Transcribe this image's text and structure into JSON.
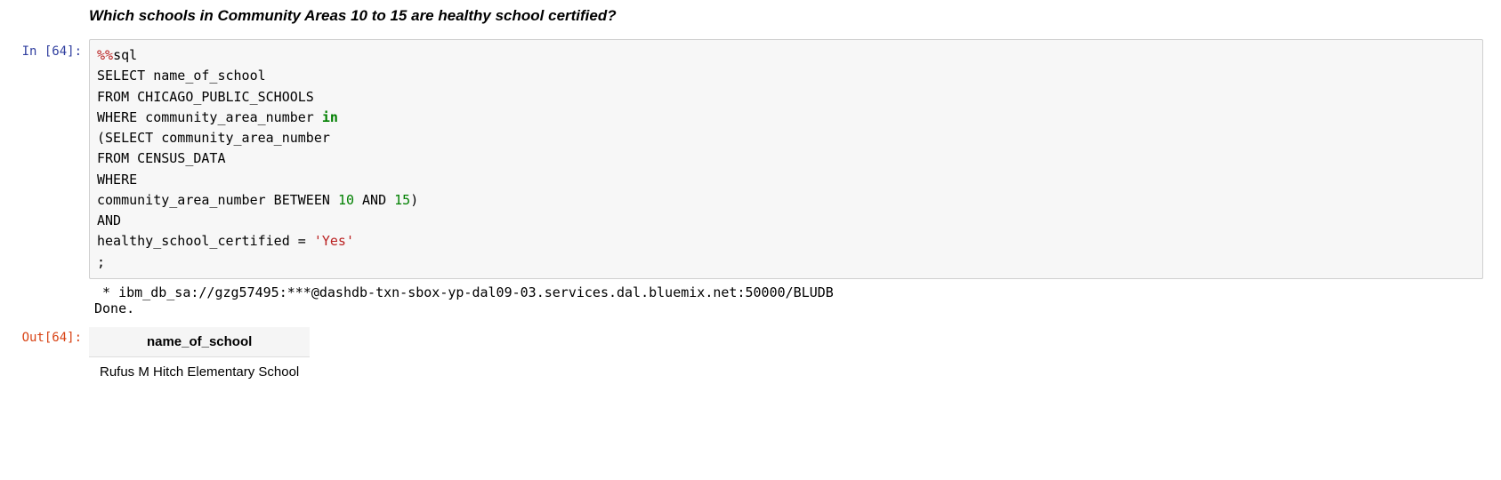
{
  "markdown": {
    "heading": "Which schools in Community Areas 10 to 15 are healthy school certified?"
  },
  "input": {
    "prompt": "In [64]:",
    "code": {
      "magic": "%%",
      "magic_name": "sql",
      "line1": "SELECT name_of_school",
      "line2": "FROM CHICAGO_PUBLIC_SCHOOLS",
      "line3a": "WHERE community_area_number ",
      "kw_in": "in",
      "line4": "(SELECT community_area_number",
      "line5": "FROM CENSUS_DATA",
      "line6": "WHERE",
      "line7a": "community_area_number BETWEEN ",
      "num10": "10",
      "line7b": " AND ",
      "num15": "15",
      "line7c": ")",
      "line8": "AND",
      "line9a": "healthy_school_certified = ",
      "str_yes": "'Yes'",
      "line10": ";"
    }
  },
  "stdout": {
    "conn": " * ibm_db_sa://gzg57495:***@dashdb-txn-sbox-yp-dal09-03.services.dal.bluemix.net:50000/BLUDB",
    "done": "Done."
  },
  "output": {
    "prompt": "Out[64]:",
    "table": {
      "header": "name_of_school",
      "row1": "Rufus M Hitch Elementary School"
    }
  }
}
